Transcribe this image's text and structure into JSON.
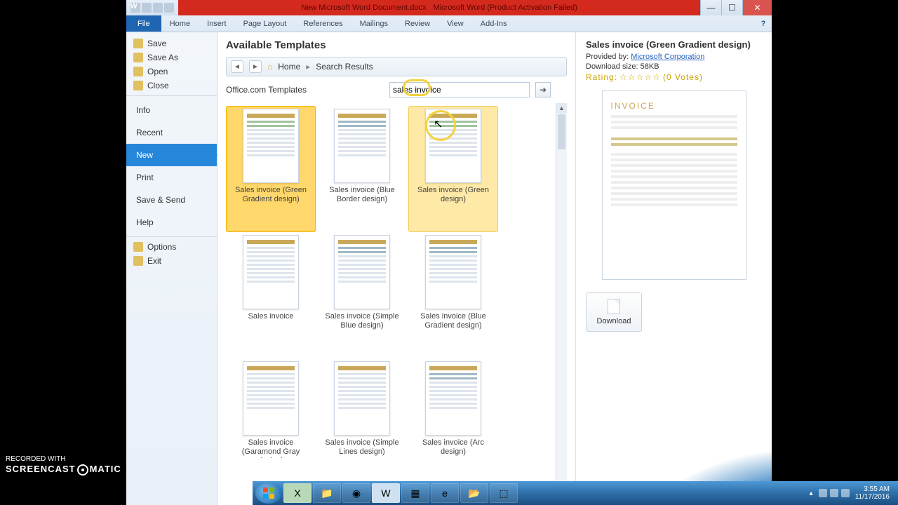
{
  "titlebar": {
    "doc_title": "New Microsoft Word Document.docx",
    "app_title": "Microsoft Word (Product Activation Failed)"
  },
  "ribbon": {
    "file": "File",
    "tabs": [
      "Home",
      "Insert",
      "Page Layout",
      "References",
      "Mailings",
      "Review",
      "View",
      "Add-Ins"
    ]
  },
  "leftnav": {
    "small_top": [
      {
        "label": "Save",
        "icon": "save-icon"
      },
      {
        "label": "Save As",
        "icon": "saveas-icon"
      },
      {
        "label": "Open",
        "icon": "open-icon"
      },
      {
        "label": "Close",
        "icon": "close-icon"
      }
    ],
    "big": [
      {
        "label": "Info",
        "sel": false
      },
      {
        "label": "Recent",
        "sel": false
      },
      {
        "label": "New",
        "sel": true
      },
      {
        "label": "Print",
        "sel": false
      },
      {
        "label": "Save & Send",
        "sel": false
      },
      {
        "label": "Help",
        "sel": false
      }
    ],
    "small_bottom": [
      {
        "label": "Options",
        "icon": "options-icon"
      },
      {
        "label": "Exit",
        "icon": "exit-icon"
      }
    ]
  },
  "center": {
    "heading": "Available Templates",
    "crumb_home": "Home",
    "crumb_results": "Search Results",
    "search_label": "Office.com Templates",
    "search_value": "sales invoice",
    "templates": [
      {
        "label": "Sales invoice (Green Gradient design)",
        "sel": true,
        "accent": "g"
      },
      {
        "label": "Sales invoice (Blue Border design)",
        "sel": false,
        "accent": "b"
      },
      {
        "label": "Sales invoice (Green design)",
        "sel": false,
        "hov": true,
        "accent": "g"
      },
      {
        "label": "Sales invoice",
        "sel": false,
        "accent": ""
      },
      {
        "label": "Sales invoice (Simple Blue design)",
        "sel": false,
        "accent": "b"
      },
      {
        "label": "Sales invoice (Blue Gradient design)",
        "sel": false,
        "accent": "b"
      },
      {
        "label": "Sales invoice (Garamond Gray design)",
        "sel": false,
        "accent": ""
      },
      {
        "label": "Sales invoice (Simple Lines design)",
        "sel": false,
        "accent": ""
      },
      {
        "label": "Sales invoice (Arc design)",
        "sel": false,
        "accent": "b"
      }
    ]
  },
  "right": {
    "title": "Sales invoice (Green Gradient design)",
    "provided_lbl": "Provided by:",
    "provided_by": "Microsoft Corporation",
    "size_lbl": "Download size:",
    "size": "58KB",
    "rating_lbl": "Rating:",
    "votes": "(0 Votes)",
    "preview_head": "INVOICE",
    "download": "Download"
  },
  "taskbar": {
    "time": "3:55 AM",
    "date": "11/17/2016"
  },
  "watermark": {
    "l1": "RECORDED WITH",
    "l2a": "SCREENCAST",
    "l2b": "MATIC"
  }
}
